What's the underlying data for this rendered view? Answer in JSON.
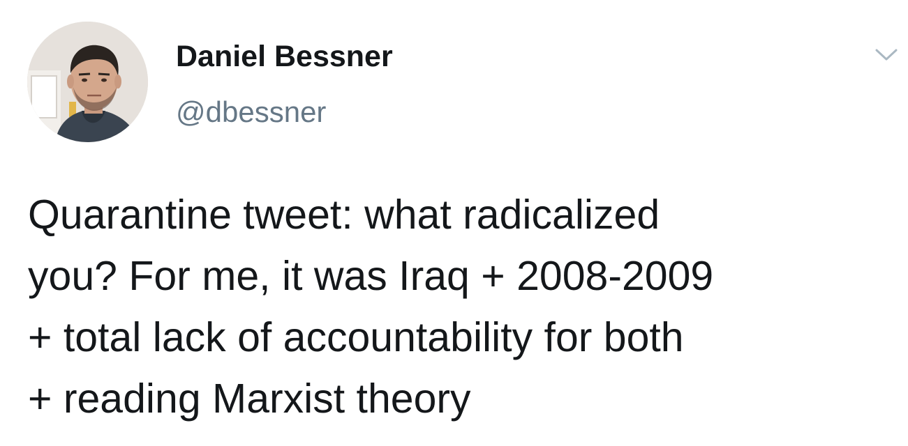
{
  "author": {
    "display_name": "Daniel Bessner",
    "handle": "@dbessner",
    "avatar_icon": "profile-photo"
  },
  "tweet": {
    "lines": [
      "Quarantine tweet: what radicalized",
      "you? For me, it was Iraq + 2008-2009",
      "+ total lack of accountability for both",
      "+ reading Marxist theory"
    ]
  },
  "menu": {
    "icon": "chevron-down-icon"
  },
  "colors": {
    "text": "#14171a",
    "handle": "#657786",
    "chevron": "#aab8c2",
    "background": "#ffffff"
  }
}
